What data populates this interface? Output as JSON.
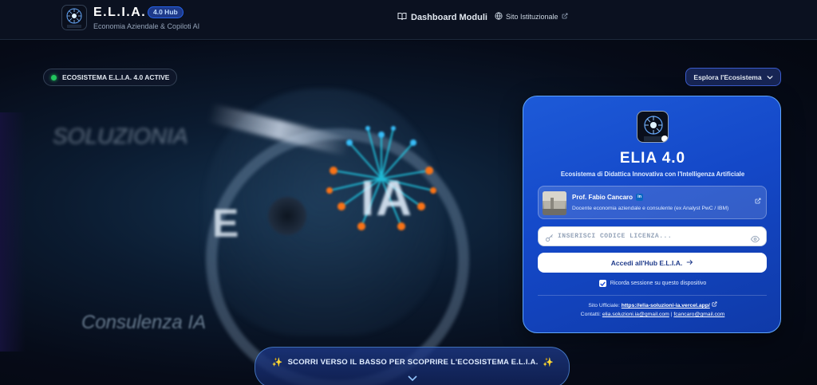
{
  "header": {
    "brand_title": "E.L.I.A.",
    "version_badge": "4.0 Hub",
    "brand_subtitle": "Economia Aziendale & Copiloti AI",
    "nav_dashboard": "Dashboard Moduli",
    "nav_site": "Sito Istituzionale"
  },
  "hero": {
    "status_text": "ECOSISTEMA E.L.I.A. 4.0 ACTIVE",
    "explore_label": "Esplora l'Ecosistema",
    "bg_text_ia": "IA",
    "bg_text_e": "E",
    "bg_text_logo": "SOLUZIONIA",
    "bg_text_consulenza": "Consulenza IA"
  },
  "card": {
    "title": "ELIA 4.0",
    "subtitle": "Ecosistema di Didattica Innovativa con l'Intelligenza Artificiale",
    "prof_name": "Prof. Fabio Cancaro",
    "prof_badge": "in",
    "prof_desc": "Docente economia aziendale e consulente (ex Analyst PwC / IBM)",
    "license_placeholder": "INSERISCI CODICE LICENZA...",
    "license_value": "",
    "submit_label": "Accedi all'Hub E.L.I.A.",
    "remember_label": "Ricorda sessione su questo dispositivo",
    "remember_checked": true,
    "official_prefix": "Sito Ufficiale:",
    "official_link": "https://elia-soluzioni-ia.vercel.app/",
    "contacts_prefix": "Contatti:",
    "email_1": "elia.soluzioni.ia@gmail.com",
    "contacts_sep": "|",
    "email_2": "fcancaro@gmail.com"
  },
  "scroll_banner": {
    "text": "SCORRI VERSO IL BASSO PER SCOPRIRE L'ECOSISTEMA E.L.I.A."
  },
  "colors": {
    "accent": "#1d5ad8",
    "status_active": "#22c55e",
    "background": "#050914"
  },
  "icons": {
    "dashboard": "book-open-icon",
    "site": "globe-icon",
    "external": "external-link-icon",
    "explore": "chevron-down-icon",
    "license": "key-icon",
    "visibility": "eye-icon",
    "submit": "arrow-right-icon",
    "banner": "sparkles-icon"
  }
}
